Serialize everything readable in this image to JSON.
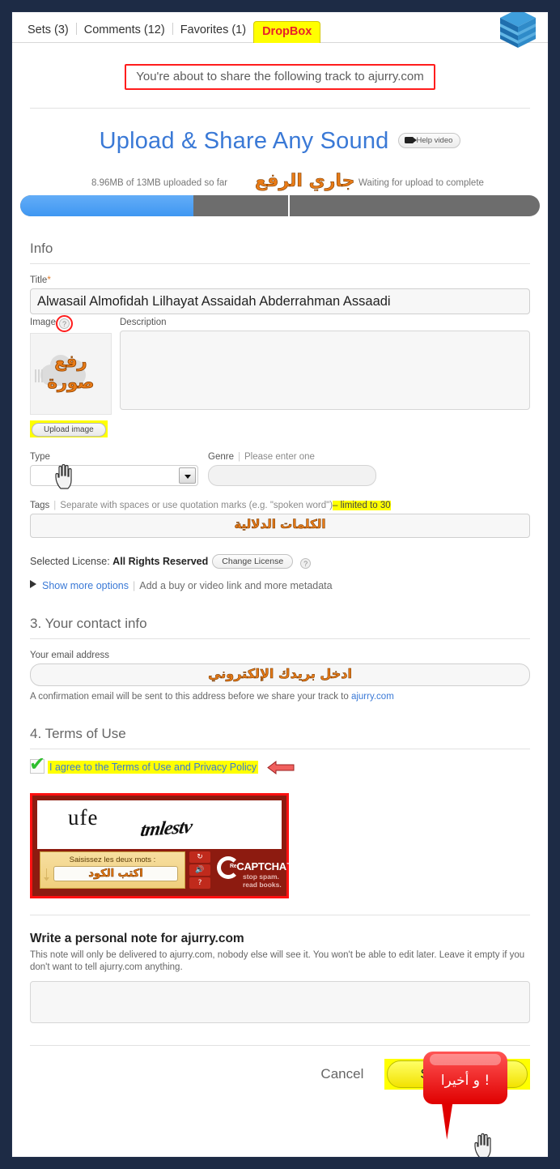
{
  "tabs": [
    {
      "label": "Sets (3)",
      "active": false
    },
    {
      "label": "Comments (12)",
      "active": false
    },
    {
      "label": "Favorites (1)",
      "active": false
    },
    {
      "label": "DropBox",
      "active": true
    }
  ],
  "logo": {
    "name": "dropbox-cube-icon",
    "color": "#2e8fd4"
  },
  "notice": {
    "text": "You're about to share the following track to ajurry.com",
    "border_color": "#ff1d1d"
  },
  "headline": {
    "title": "Upload & Share Any Sound",
    "title_color": "#3a79d6",
    "help_video_label": "Help video"
  },
  "progress": {
    "uploaded_label": "8.96MB of 13MB uploaded so far",
    "waiting_label": "Waiting for upload to complete",
    "annotation_arabic": "جاري الرفع",
    "percent": 33,
    "divider_percent": 51,
    "fill_color": "#4da2f5",
    "track_color": "#6d6d6d"
  },
  "info": {
    "section_title": "Info",
    "title_label": "Title",
    "title_required_mark": "*",
    "title_value": "Alwasail Almofidah Lilhayat Assaidah Abderrahman Assaadi",
    "image_label": "Image",
    "image_help": "?",
    "image_placeholder_arabic_line1": "رفع",
    "image_placeholder_arabic_line2": "صورة",
    "upload_image_button": "Upload image",
    "description_label": "Description",
    "description_value": "",
    "type_label": "Type",
    "type_value": "",
    "genre_label": "Genre",
    "genre_hint": "Please enter one",
    "genre_value": "",
    "tags_label": "Tags",
    "tags_hint": "Separate with spaces or use quotation marks (e.g. \"spoken word\")",
    "tags_limit": "– limited to 30",
    "tags_annotation_arabic": "الكلمات الدلالية",
    "license_prefix": "Selected License:",
    "license_value": "All Rights Reserved",
    "change_license_button": "Change License",
    "license_help": "?",
    "show_more_options": "Show more options",
    "show_more_hint": "Add a buy or video link and more metadata"
  },
  "contact": {
    "section_title": "3. Your contact info",
    "email_label": "Your email address",
    "email_value": "",
    "email_annotation_arabic": "ادخل بريدك الإلكتروني",
    "confirmation_note_before": "A confirmation email will be sent to this address before we share your track to",
    "confirmation_note_link": "ajurry.com"
  },
  "terms": {
    "section_title": "4. Terms of Use",
    "agree_label": "I agree to the Terms of Use and Privacy Policy",
    "checked": true,
    "highlight_color": "#ffff00",
    "arrow_color": "#f0605e"
  },
  "captcha": {
    "word_one": "ufe",
    "word_two": "tmlestv",
    "prompt_french": "Saisissez les deux mots :",
    "input_annotation_arabic": "اكتب الكود",
    "input_value": "",
    "brand_re": "Re",
    "brand_main": "CAPTCHA",
    "brand_tm": "™",
    "tagline_line1": "stop spam.",
    "tagline_line2": "read books.",
    "buttons": [
      "↻",
      "🔊",
      "?"
    ],
    "border_color": "#ff1111"
  },
  "personal_note": {
    "title": "Write a personal note for ajurry.com",
    "description": "This note will only be delivered to ajurry.com, nobody else will see it. You won't be able to edit later. Leave it empty if you don't want to tell ajurry.com anything.",
    "value": ""
  },
  "callout": {
    "text": "و أخيرا !",
    "color": "#e00000"
  },
  "footer": {
    "cancel_label": "Cancel",
    "share_label": "Share Track",
    "share_highlight": "#ffff00"
  }
}
